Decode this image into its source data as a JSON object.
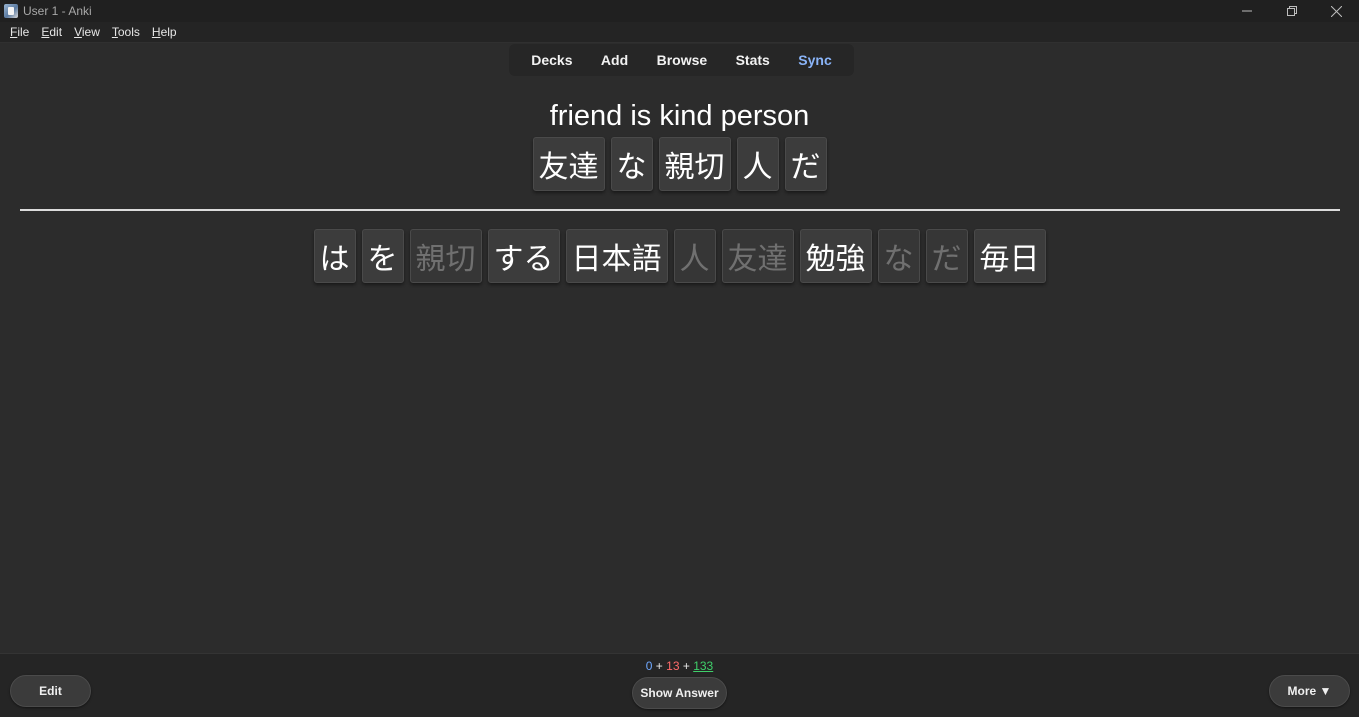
{
  "window": {
    "title": "User 1 - Anki"
  },
  "menu": [
    {
      "mnemonic": "F",
      "rest": "ile"
    },
    {
      "mnemonic": "E",
      "rest": "dit"
    },
    {
      "mnemonic": "V",
      "rest": "iew"
    },
    {
      "mnemonic": "T",
      "rest": "ools"
    },
    {
      "mnemonic": "H",
      "rest": "elp"
    }
  ],
  "toolbar": {
    "decks": "Decks",
    "add": "Add",
    "browse": "Browse",
    "stats": "Stats",
    "sync": "Sync",
    "sync_color": "#8ab4f8"
  },
  "card": {
    "prompt": "friend is kind person",
    "answer_tiles": [
      "友達",
      "な",
      "親切",
      "人",
      "だ"
    ],
    "pool_tiles": [
      {
        "text": "は",
        "used": false
      },
      {
        "text": "を",
        "used": false
      },
      {
        "text": "親切",
        "used": true
      },
      {
        "text": "する",
        "used": false
      },
      {
        "text": "日本語",
        "used": false
      },
      {
        "text": "人",
        "used": true
      },
      {
        "text": "友達",
        "used": true
      },
      {
        "text": "勉強",
        "used": false
      },
      {
        "text": "な",
        "used": true
      },
      {
        "text": "だ",
        "used": true
      },
      {
        "text": "毎日",
        "used": false
      }
    ]
  },
  "bottom": {
    "edit": "Edit",
    "show_answer": "Show Answer",
    "more": "More ▼",
    "counts": {
      "new": "0",
      "plus1": " + ",
      "learn": "13",
      "plus2": " + ",
      "review": "133"
    },
    "colors": {
      "new": "#6fa8ff",
      "learn": "#ff6b6b",
      "review": "#3fcf6a"
    }
  }
}
